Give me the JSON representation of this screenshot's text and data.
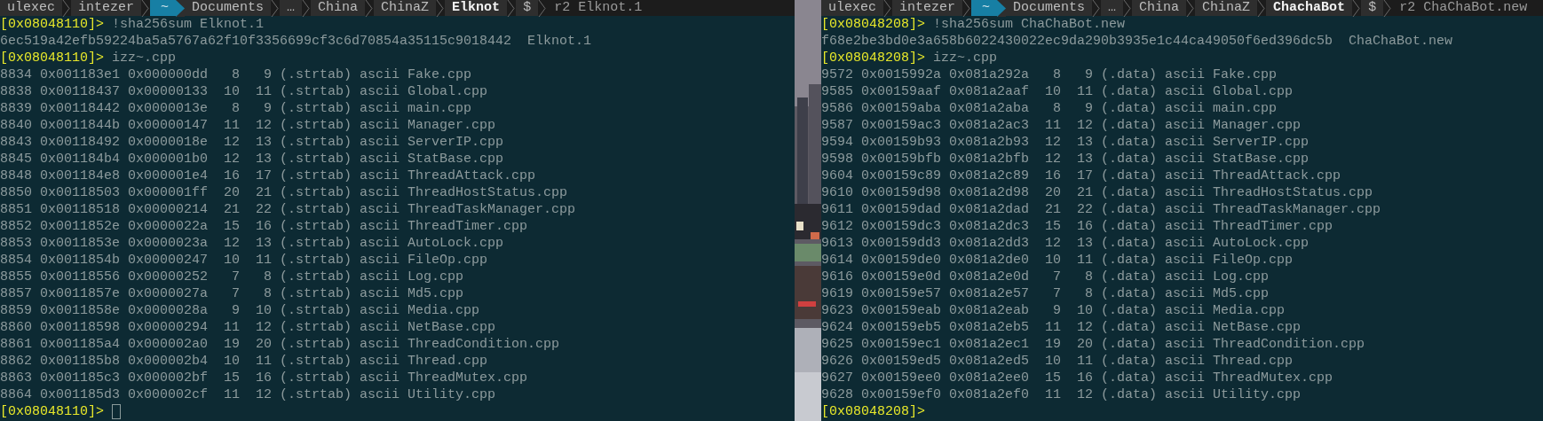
{
  "panes": [
    {
      "prompt_bar": {
        "segments": [
          {
            "label": "ulexec",
            "kind": "plain"
          },
          {
            "label": "intezer",
            "kind": "plain"
          },
          {
            "label": "~",
            "kind": "home"
          },
          {
            "label": "Documents",
            "kind": "plain"
          },
          {
            "label": "…",
            "kind": "plain"
          },
          {
            "label": "China",
            "kind": "plain"
          },
          {
            "label": "ChinaZ",
            "kind": "plain"
          },
          {
            "label": "Elknot",
            "kind": "current"
          },
          {
            "label": "$",
            "kind": "plain"
          }
        ],
        "command": "r2 Elknot.1"
      },
      "lines": [
        {
          "prompt": "[0x08048110]>",
          "text": " !sha256sum Elknot.1"
        },
        {
          "text": "6ec519a42efb59224ba5a5767a62f10f3356699cf3c6d70854a35115c9018442  Elknot.1"
        },
        {
          "prompt": "[0x08048110]>",
          "text": " izz~.cpp"
        },
        {
          "text": "8834 0x001183e1 0x000000dd   8   9 (.strtab) ascii Fake.cpp"
        },
        {
          "text": "8838 0x00118437 0x00000133  10  11 (.strtab) ascii Global.cpp"
        },
        {
          "text": "8839 0x00118442 0x0000013e   8   9 (.strtab) ascii main.cpp"
        },
        {
          "text": "8840 0x0011844b 0x00000147  11  12 (.strtab) ascii Manager.cpp"
        },
        {
          "text": "8843 0x00118492 0x0000018e  12  13 (.strtab) ascii ServerIP.cpp"
        },
        {
          "text": "8845 0x001184b4 0x000001b0  12  13 (.strtab) ascii StatBase.cpp"
        },
        {
          "text": "8848 0x001184e8 0x000001e4  16  17 (.strtab) ascii ThreadAttack.cpp"
        },
        {
          "text": "8850 0x00118503 0x000001ff  20  21 (.strtab) ascii ThreadHostStatus.cpp"
        },
        {
          "text": "8851 0x00118518 0x00000214  21  22 (.strtab) ascii ThreadTaskManager.cpp"
        },
        {
          "text": "8852 0x0011852e 0x0000022a  15  16 (.strtab) ascii ThreadTimer.cpp"
        },
        {
          "text": "8853 0x0011853e 0x0000023a  12  13 (.strtab) ascii AutoLock.cpp"
        },
        {
          "text": "8854 0x0011854b 0x00000247  10  11 (.strtab) ascii FileOp.cpp"
        },
        {
          "text": "8855 0x00118556 0x00000252   7   8 (.strtab) ascii Log.cpp"
        },
        {
          "text": "8857 0x0011857e 0x0000027a   7   8 (.strtab) ascii Md5.cpp"
        },
        {
          "text": "8859 0x0011858e 0x0000028a   9  10 (.strtab) ascii Media.cpp"
        },
        {
          "text": "8860 0x00118598 0x00000294  11  12 (.strtab) ascii NetBase.cpp"
        },
        {
          "text": "8861 0x001185a4 0x000002a0  19  20 (.strtab) ascii ThreadCondition.cpp"
        },
        {
          "text": "8862 0x001185b8 0x000002b4  10  11 (.strtab) ascii Thread.cpp"
        },
        {
          "text": "8863 0x001185c3 0x000002bf  15  16 (.strtab) ascii ThreadMutex.cpp"
        },
        {
          "text": "8864 0x001185d3 0x000002cf  11  12 (.strtab) ascii Utility.cpp"
        },
        {
          "prompt": "[0x08048110]>",
          "cursor": true
        }
      ]
    },
    {
      "prompt_bar": {
        "segments": [
          {
            "label": "ulexec",
            "kind": "plain"
          },
          {
            "label": "intezer",
            "kind": "plain"
          },
          {
            "label": "~",
            "kind": "home"
          },
          {
            "label": "Documents",
            "kind": "plain"
          },
          {
            "label": "…",
            "kind": "plain"
          },
          {
            "label": "China",
            "kind": "plain"
          },
          {
            "label": "ChinaZ",
            "kind": "plain"
          },
          {
            "label": "ChachaBot",
            "kind": "current"
          },
          {
            "label": "$",
            "kind": "plain"
          }
        ],
        "command": "r2 ChaChaBot.new"
      },
      "lines": [
        {
          "prompt": "[0x08048208]>",
          "text": " !sha256sum ChaChaBot.new"
        },
        {
          "text": "f68e2be3bd0e3a658b6022430022ec9da290b3935e1c44ca49050f6ed396dc5b  ChaChaBot.new"
        },
        {
          "prompt": "[0x08048208]>",
          "text": " izz~.cpp"
        },
        {
          "text": "9572 0x0015992a 0x081a292a   8   9 (.data) ascii Fake.cpp"
        },
        {
          "text": "9585 0x00159aaf 0x081a2aaf  10  11 (.data) ascii Global.cpp"
        },
        {
          "text": "9586 0x00159aba 0x081a2aba   8   9 (.data) ascii main.cpp"
        },
        {
          "text": "9587 0x00159ac3 0x081a2ac3  11  12 (.data) ascii Manager.cpp"
        },
        {
          "text": "9594 0x00159b93 0x081a2b93  12  13 (.data) ascii ServerIP.cpp"
        },
        {
          "text": "9598 0x00159bfb 0x081a2bfb  12  13 (.data) ascii StatBase.cpp"
        },
        {
          "text": "9604 0x00159c89 0x081a2c89  16  17 (.data) ascii ThreadAttack.cpp"
        },
        {
          "text": "9610 0x00159d98 0x081a2d98  20  21 (.data) ascii ThreadHostStatus.cpp"
        },
        {
          "text": "9611 0x00159dad 0x081a2dad  21  22 (.data) ascii ThreadTaskManager.cpp"
        },
        {
          "text": "9612 0x00159dc3 0x081a2dc3  15  16 (.data) ascii ThreadTimer.cpp"
        },
        {
          "text": "9613 0x00159dd3 0x081a2dd3  12  13 (.data) ascii AutoLock.cpp"
        },
        {
          "text": "9614 0x00159de0 0x081a2de0  10  11 (.data) ascii FileOp.cpp"
        },
        {
          "text": "9616 0x00159e0d 0x081a2e0d   7   8 (.data) ascii Log.cpp"
        },
        {
          "text": "9619 0x00159e57 0x081a2e57   7   8 (.data) ascii Md5.cpp"
        },
        {
          "text": "9623 0x00159eab 0x081a2eab   9  10 (.data) ascii Media.cpp"
        },
        {
          "text": "9624 0x00159eb5 0x081a2eb5  11  12 (.data) ascii NetBase.cpp"
        },
        {
          "text": "9625 0x00159ec1 0x081a2ec1  19  20 (.data) ascii ThreadCondition.cpp"
        },
        {
          "text": "9626 0x00159ed5 0x081a2ed5  10  11 (.data) ascii Thread.cpp"
        },
        {
          "text": "9627 0x00159ee0 0x081a2ee0  15  16 (.data) ascii ThreadMutex.cpp"
        },
        {
          "text": "9628 0x00159ef0 0x081a2ef0  11  12 (.data) ascii Utility.cpp"
        },
        {
          "prompt": "[0x08048208]>",
          "cursor": false
        }
      ]
    }
  ]
}
